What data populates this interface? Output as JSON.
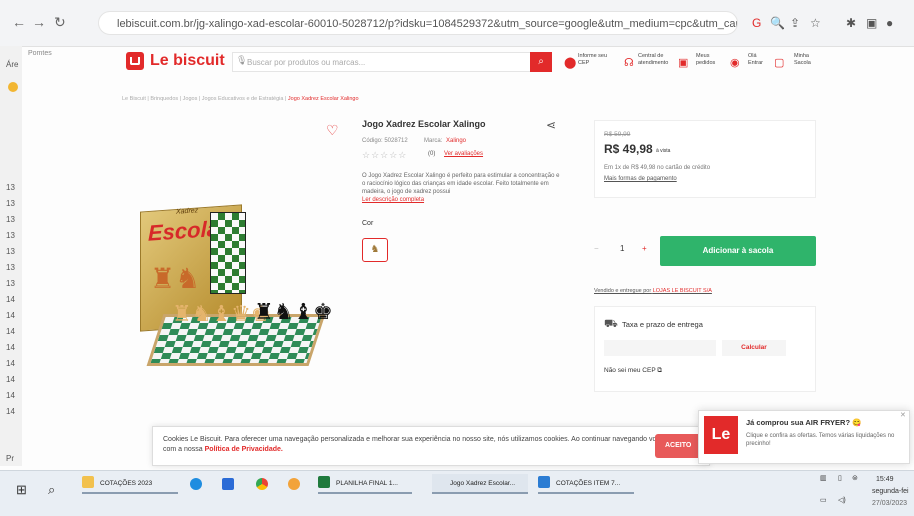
{
  "browser": {
    "url": "lebiscuit.com.br/jg-xalingo-xad-escolar-60010-5028712/p?idsku=1084529372&utm_source=google&utm_medium=cpc&utm_campaign=GOOGLE-P...",
    "bookmarks_label": "Pomtes"
  },
  "left_column": {
    "label_top": "Áre",
    "numbers": [
      "13",
      "13",
      "13",
      "13",
      "13",
      "13",
      "13",
      "14",
      "14",
      "14",
      "14",
      "14",
      "14",
      "14",
      "14"
    ],
    "bottom": "Pr"
  },
  "header": {
    "logo": "Le biscuit",
    "search_placeholder": "Buscar por produtos ou marcas...",
    "inform_cep": "Informe seu CEP",
    "support": "Central de atendimento",
    "orders": "Meus pedidos",
    "login": "Olá Entrar",
    "bag": "Minha Sacola"
  },
  "breadcrumb": {
    "path": "Le Biscuit  |  Brinquedos  |  Jogos  |  Jogos Educativos e de Estratégia  |",
    "current": "Jogo Xadrez Escolar Xalingo"
  },
  "product": {
    "title": "Jogo Xadrez Escolar Xalingo",
    "code_label": "Código: 5028712",
    "brand_label": "Marca:",
    "brand": "Xalingo",
    "stars": "☆☆☆☆☆",
    "rating_count": "(0)",
    "review_link": "Ver avaliações",
    "description": "O Jogo Xadrez Escolar Xalingo é perfeito para estimular a concentração e o raciocínio lógico das crianças em idade escolar. Feito totalmente em madeira, o jogo de xadrez possui",
    "read_more": "Ler descrição completa",
    "color_label": "Cor",
    "box_title": "Escolar",
    "box_brand": "Xadrez"
  },
  "pricing": {
    "old_price": "R$ 59,99",
    "price": "R$ 49,98",
    "pix": "à vista",
    "installments": "Em 1x de R$ 49,98 no cartão de crédito",
    "more_payment": "Mais formas de pagamento",
    "quantity": "1",
    "minus": "−",
    "plus": "+",
    "add_button": "Adicionar à sacola",
    "sold_by": "Vendido e entregue por",
    "seller": "LOJAS LE BISCUIT S/A"
  },
  "shipping": {
    "title": "Taxa e prazo de entrega",
    "calc_button": "Calcular",
    "no_cep": "Não sei meu CEP ⧉"
  },
  "cookie": {
    "text": "Cookies Le Biscuit. Para oferecer uma navegação personalizada e melhorar sua experiência no nosso site, nós utilizamos cookies. Ao continuar navegando você concorda com a nossa",
    "policy": "Política de Privacidade.",
    "accept": "ACEITO"
  },
  "notification": {
    "logo": "Le",
    "title": "Já comprou sua AIR FRYER? 😋",
    "body": "Clique e confira as ofertas. Temos várias liquidações no precinho!"
  },
  "taskbar": {
    "apps": [
      "COTAÇÕES 2023",
      "PLANILHA FINAL 1...",
      "Jogo Xadrez Escolar...",
      "COTAÇÕES ITEM 7..."
    ],
    "time": "15:49",
    "day": "segunda-fei",
    "date": "27/03/2023"
  },
  "colors": {
    "brand_red": "#e22a2a",
    "add_green": "#2fb46b"
  }
}
